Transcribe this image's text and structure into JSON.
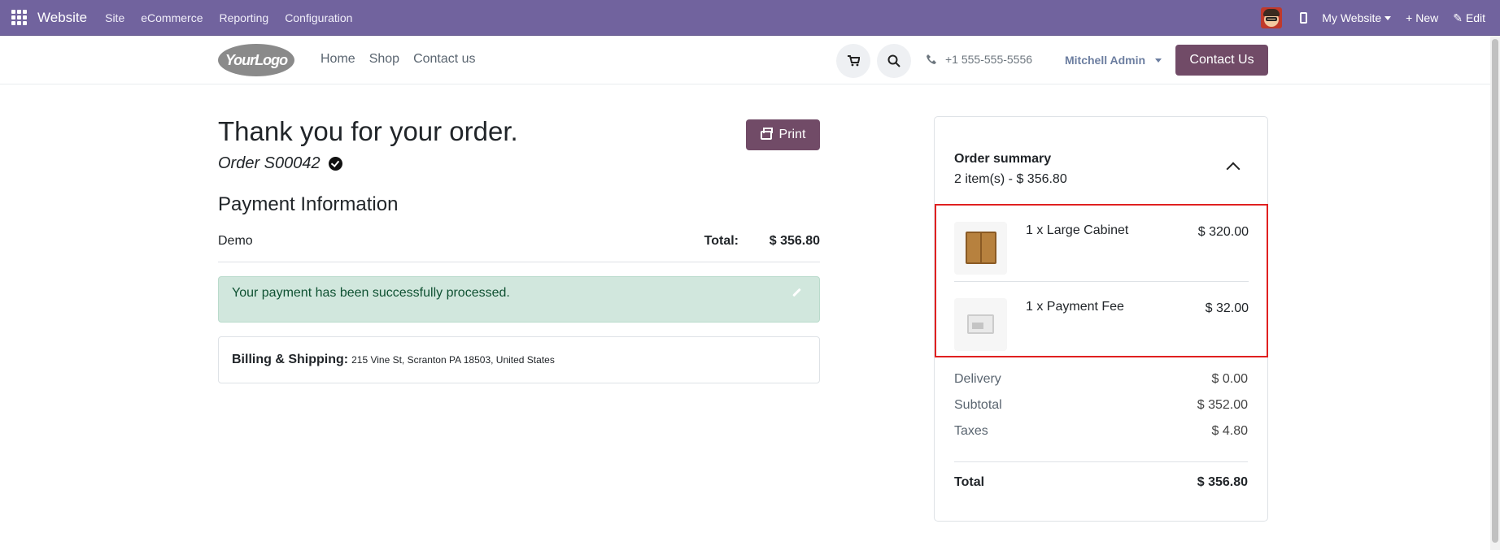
{
  "adminbar": {
    "brand": "Website",
    "menus": [
      "Site",
      "eCommerce",
      "Reporting",
      "Configuration"
    ],
    "website_label": "My Website",
    "new_label": "+ New",
    "edit_label": "Edit"
  },
  "header": {
    "logo_text": "YourLogo",
    "nav": [
      "Home",
      "Shop",
      "Contact us"
    ],
    "phone": "+1 555-555-5556",
    "user": "Mitchell Admin",
    "contact_button": "Contact Us"
  },
  "order": {
    "title": "Thank you for your order.",
    "number": "Order S00042",
    "print_label": "Print"
  },
  "payment": {
    "heading": "Payment Information",
    "method": "Demo",
    "total_label": "Total:",
    "total_value": "$ 356.80",
    "success_message": "Your payment has been successfully processed."
  },
  "billing": {
    "label": "Billing & Shipping:",
    "address": "215 Vine St, Scranton PA 18503, United States"
  },
  "summary": {
    "title": "Order summary",
    "subtitle": "2 item(s) -  $ 356.80",
    "lines": [
      {
        "name": "1 x Large Cabinet",
        "price": "$ 320.00"
      },
      {
        "name": "1 x Payment Fee",
        "price": "$ 32.00"
      }
    ],
    "delivery_label": "Delivery",
    "delivery_value": "$ 0.00",
    "subtotal_label": "Subtotal",
    "subtotal_value": "$ 352.00",
    "taxes_label": "Taxes",
    "taxes_value": "$ 4.80",
    "total_label": "Total",
    "total_value": "$ 356.80"
  },
  "colors": {
    "admin_bar": "#71639e",
    "primary_button": "#714b67",
    "success_bg": "#d1e7dd",
    "highlight_border": "#e02020"
  }
}
